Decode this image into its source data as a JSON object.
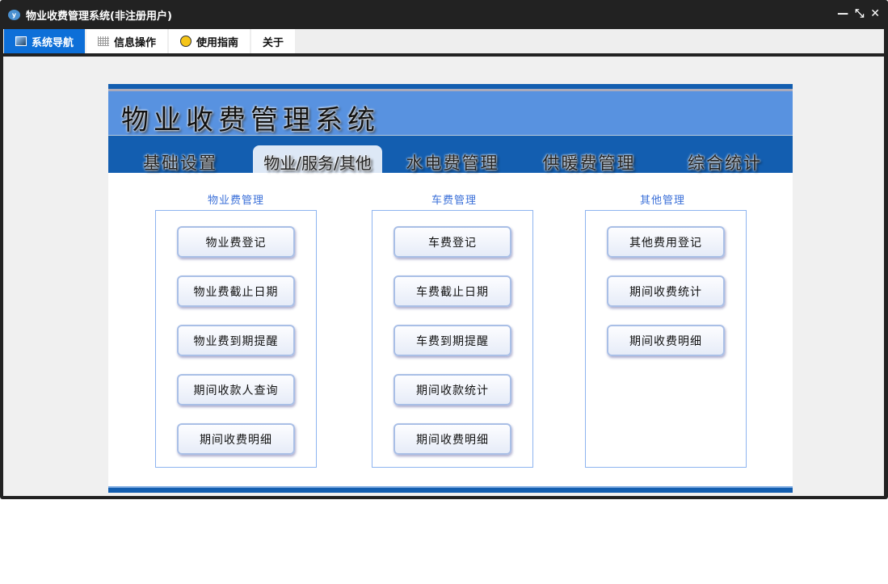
{
  "window": {
    "title": "物业收费管理系统(非注册用户)",
    "logo": "y",
    "controls": [
      "—",
      "⤡",
      "✕"
    ]
  },
  "tabs": [
    {
      "label": "系统导航",
      "icon": "monitor-icon"
    },
    {
      "label": "信息操作",
      "icon": "grid-icon"
    },
    {
      "label": "使用指南",
      "icon": "help-icon"
    },
    {
      "label": "关于"
    }
  ],
  "app": {
    "title": "物业收费管理系统",
    "nav": [
      "基础设置",
      "物业/服务/其他",
      "水电费管理",
      "供暖费管理",
      "综合统计"
    ],
    "active_nav": 1
  },
  "groups": [
    {
      "title": "物业费管理",
      "buttons": [
        "物业费登记",
        "物业费截止日期",
        "物业费到期提醒",
        "期间收款人查询",
        "期间收费明细"
      ]
    },
    {
      "title": "车费管理",
      "buttons": [
        "车费登记",
        "车费截止日期",
        "车费到期提醒",
        "期间收款统计",
        "期间收费明细"
      ]
    },
    {
      "title": "其他管理",
      "buttons": [
        "其他费用登记",
        "期间收费统计",
        "期间收费明细"
      ]
    }
  ]
}
